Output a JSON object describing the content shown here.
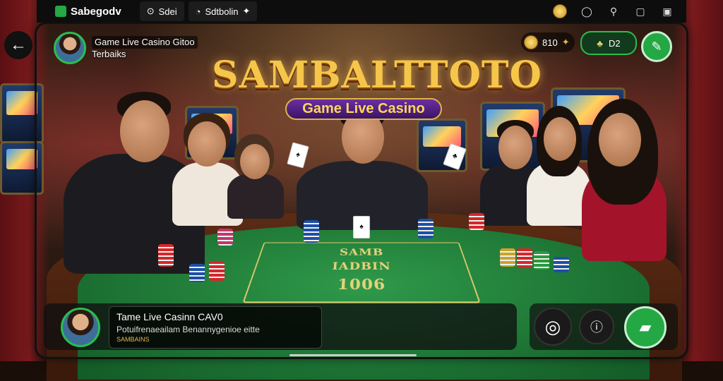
{
  "topbar": {
    "app_name": "Sabegodv",
    "tab2": "Sdei",
    "tab3": "Sdtbolin",
    "icons": [
      "coin-icon",
      "chat-icon",
      "link-icon",
      "square-icon",
      "window-icon"
    ]
  },
  "host": {
    "title": "Game Live Casino Gitoo",
    "subtitle": "Terbaiks"
  },
  "logo": {
    "brand": "SAMBALTTOTO",
    "tagline": "Game Live Casino"
  },
  "balance": {
    "coins": "810"
  },
  "gift": {
    "count": "D2"
  },
  "felt": {
    "line1": "SAMB",
    "line2": "IADBIN",
    "line3": "1006"
  },
  "message": {
    "title": "Tame Live Casinn CAV0",
    "body": "Potuifrenaeailam Benannygenioe eitte",
    "meta": "SAMBAINS"
  },
  "colors": {
    "accent_green": "#24a844",
    "felt": "#1d7434",
    "gold": "#f5c64a"
  }
}
